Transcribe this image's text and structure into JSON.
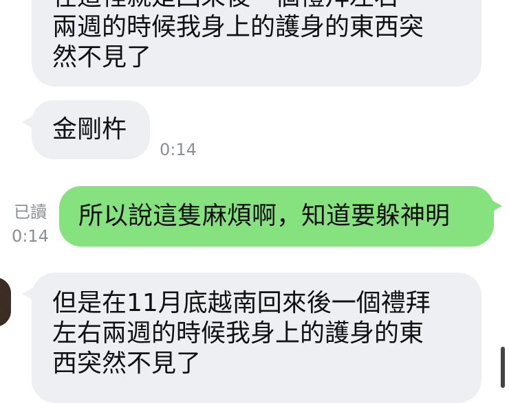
{
  "messages": [
    {
      "text": "在這裡就是回來後一個禮拜左右\n兩週的時候我身上的護身的東西突\n然不見了"
    },
    {
      "text": "金剛杵",
      "time": "0:14"
    },
    {
      "text": "所以說這隻麻煩啊，知道要躲神明",
      "read": "已讀",
      "time": "0:14"
    },
    {
      "text": "但是在11月底越南回來後一個禮拜\n左右兩週的時候我身上的護身的東\n西突然不見了"
    }
  ],
  "colors": {
    "incoming_bubble": "#edeff2",
    "outgoing_bubble": "#85e27e",
    "meta_text": "#8a8f96"
  }
}
